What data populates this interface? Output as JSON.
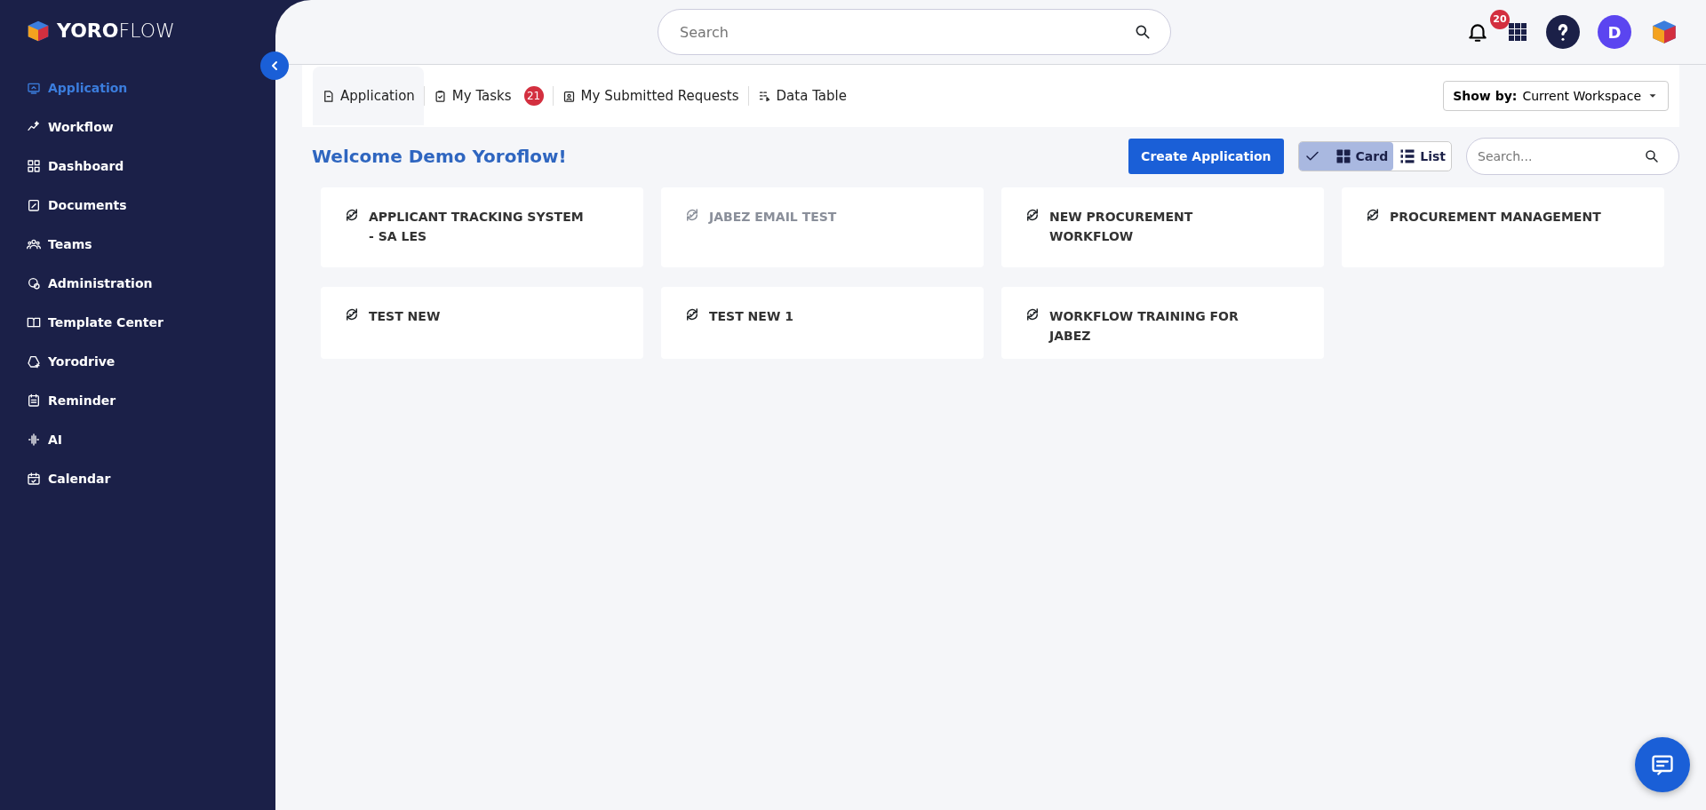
{
  "sidebar": {
    "logo": {
      "brand_bold": "YORO",
      "brand_light": "FLOW"
    },
    "items": [
      {
        "label": "Application",
        "selected": true
      },
      {
        "label": "Workflow",
        "selected": false
      },
      {
        "label": "Dashboard",
        "selected": false
      },
      {
        "label": "Documents",
        "selected": false
      },
      {
        "label": "Teams",
        "selected": false
      },
      {
        "label": "Administration",
        "selected": false
      },
      {
        "label": "Template Center",
        "selected": false
      },
      {
        "label": "Yorodrive",
        "selected": false
      },
      {
        "label": "Reminder",
        "selected": false
      },
      {
        "label": "AI",
        "selected": false
      },
      {
        "label": "Calendar",
        "selected": false
      }
    ]
  },
  "header": {
    "search": {
      "placeholder": "Search"
    },
    "notification_count": "20",
    "avatar_initial": "D"
  },
  "tabs": [
    {
      "label": "Application",
      "selected": true
    },
    {
      "label": "My Tasks",
      "badge": "21",
      "selected": false
    },
    {
      "label": "My Submitted Requests",
      "selected": false
    },
    {
      "label": "Data Table",
      "selected": false
    }
  ],
  "show_by": {
    "label": "Show by:",
    "value": "Current Workspace"
  },
  "welcome": "Welcome Demo Yoroflow!",
  "create_button": "Create Application",
  "view_toggle": [
    {
      "label": "Card",
      "selected": true
    },
    {
      "label": "List",
      "selected": false
    }
  ],
  "app_search": {
    "placeholder": "Search..."
  },
  "applications": [
    {
      "name": "APPLICANT TRACKING SYSTEM - SA LES",
      "dimmed": false
    },
    {
      "name": "JABEZ EMAIL TEST",
      "dimmed": true
    },
    {
      "name": "NEW PROCUREMENT WORKFLOW",
      "dimmed": false
    },
    {
      "name": "PROCUREMENT MANAGEMENT",
      "dimmed": false
    },
    {
      "name": "TEST NEW",
      "dimmed": false
    },
    {
      "name": "TEST NEW 1",
      "dimmed": false
    },
    {
      "name": "WORKFLOW TRAINING FOR JABEZ",
      "dimmed": false
    }
  ]
}
